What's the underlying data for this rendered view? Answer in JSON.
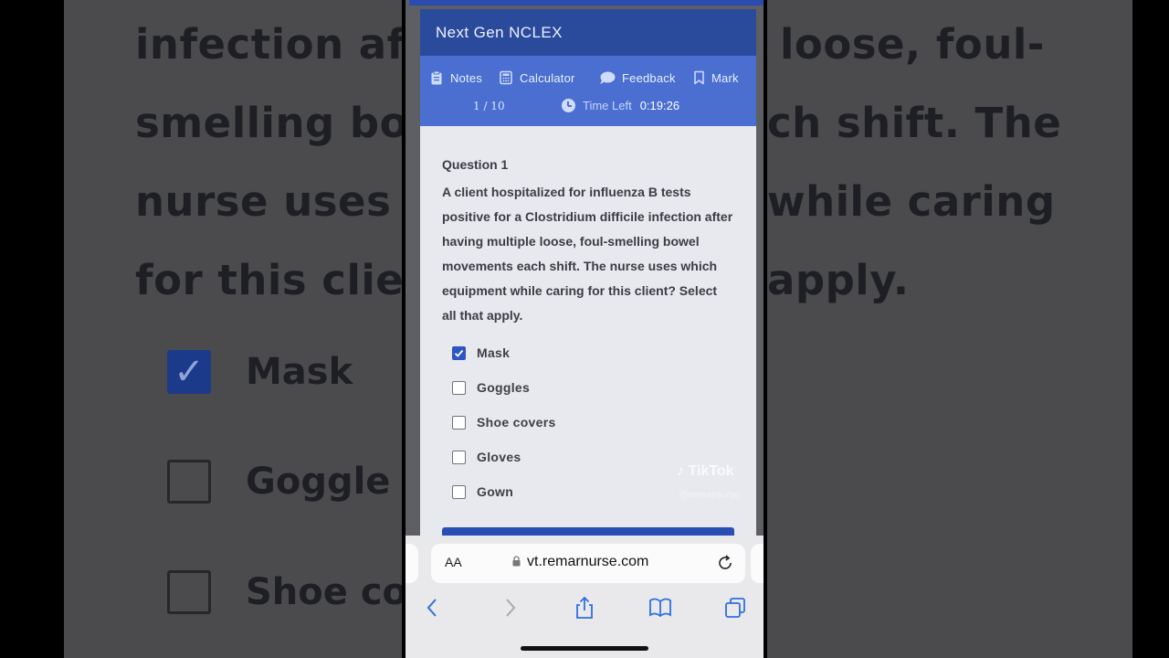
{
  "background": {
    "lines": [
      "infection afte",
      "loose, foul-",
      "smelling bow",
      "ch shift. The",
      "nurse uses w",
      "while caring",
      "for this clien",
      "apply."
    ],
    "options": [
      {
        "label": "Mask",
        "checked": true
      },
      {
        "label": "Goggle",
        "checked": false
      },
      {
        "label": "Shoe co",
        "checked": false
      }
    ]
  },
  "app": {
    "title": "Next Gen NCLEX",
    "toolbar": {
      "notes": "Notes",
      "calculator": "Calculator",
      "feedback": "Feedback",
      "mark": "Mark"
    },
    "progress": "1 / 10",
    "timer_label": "Time Left",
    "timer_value": "0:19:26",
    "question": {
      "number": "Question 1",
      "text": "A client hospitalized for influenza B tests positive for a Clostridium difficile infection after having multiple loose, foul-smelling bowel movements each shift. The nurse uses which equipment while caring for this client? Select all that apply.",
      "options": [
        {
          "label": "Mask",
          "checked": true
        },
        {
          "label": "Goggles",
          "checked": false
        },
        {
          "label": "Shoe covers",
          "checked": false
        },
        {
          "label": "Gloves",
          "checked": false
        },
        {
          "label": "Gown",
          "checked": false
        }
      ]
    }
  },
  "watermark": {
    "brand": "TikTok",
    "handle": "@remarnurse"
  },
  "browser": {
    "aa_label": "AA",
    "url": "vt.remarnurse.com"
  },
  "colors": {
    "header": "#2a4a9c",
    "toolbar": "#4a6fd0",
    "check": "#2d55c4"
  }
}
